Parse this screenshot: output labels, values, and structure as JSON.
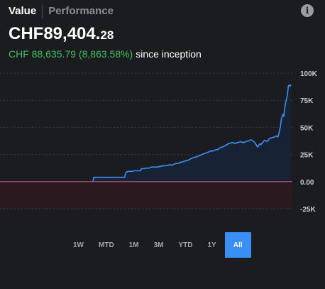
{
  "tabs": [
    {
      "label": "Value",
      "active": true
    },
    {
      "label": "Performance",
      "active": false
    }
  ],
  "info_icon": "info-icon",
  "portfolio": {
    "value_main": "CHF89,404.",
    "value_cents": "28",
    "change_amount": "CHF 88,635.79",
    "change_pct": "(8,863.58%)",
    "change_suffix": "since inception"
  },
  "colors": {
    "line": "#3b8ef5",
    "positive_fill": "#172334",
    "negative_fill": "#2a1a20",
    "baseline": "#b45a78",
    "positive_text": "#3fbf5f",
    "selected_range": "#3b8ef5"
  },
  "chart_data": {
    "type": "area",
    "y_ticks": [
      "100K",
      "75K",
      "50K",
      "25K",
      "0.00",
      "-25K"
    ],
    "ylim": [
      -25000,
      100000
    ],
    "gridlines": "dashed",
    "series": [
      {
        "values": [
          0,
          0,
          0,
          0,
          0,
          0,
          0,
          0,
          0,
          0,
          0,
          0,
          0,
          0,
          0,
          0,
          0,
          0,
          0,
          0,
          0,
          0,
          0,
          0,
          0,
          0,
          0,
          0,
          0,
          0,
          0,
          0,
          0,
          0,
          0,
          0,
          0,
          0,
          0,
          0,
          0,
          0,
          0,
          0,
          0,
          0,
          0,
          0,
          0,
          0,
          0,
          0,
          0,
          0,
          0,
          0,
          0,
          0,
          0,
          0,
          0,
          0,
          0,
          0,
          0,
          0,
          0,
          0,
          0,
          0,
          0,
          0,
          0,
          0,
          0,
          0,
          0,
          0,
          0,
          0,
          0,
          0,
          0,
          0,
          0,
          0,
          0,
          0,
          0,
          0,
          0,
          0,
          0,
          0,
          0,
          0,
          0,
          0,
          0,
          0,
          0,
          0,
          0,
          0,
          0,
          0,
          4000,
          4000,
          4000,
          4000,
          4000,
          4000,
          4000,
          4000,
          4000,
          4000,
          4000,
          4000,
          4000,
          4000,
          4000,
          4000,
          4000,
          4000,
          4000,
          4000,
          4000,
          4000,
          4000,
          4000,
          4000,
          4000,
          4000,
          4000,
          4000,
          4000,
          4000,
          4000,
          4000,
          4000,
          4000,
          4000,
          8000,
          9000,
          9000,
          9500,
          9500,
          9500,
          9500,
          9500,
          9500,
          10000,
          10000,
          10000,
          10000,
          10000,
          10000,
          10000,
          10000,
          10000,
          12000,
          12000,
          12000,
          12000,
          12000,
          12500,
          12500,
          12500,
          12500,
          12500,
          13000,
          13500,
          13500,
          13500,
          13500,
          13500,
          13500,
          13500,
          13500,
          13500,
          14000,
          14000,
          14000,
          14500,
          14500,
          14500,
          14500,
          14500,
          15000,
          15000,
          15000,
          15500,
          15500,
          15500,
          15000,
          15500,
          16000,
          16000,
          16500,
          16500,
          17000,
          17000,
          17000,
          17000,
          18000,
          18000,
          18000,
          18500,
          18500,
          19000,
          19500,
          19000,
          19500,
          20000,
          20000,
          21000,
          21000,
          21500,
          22000,
          22000,
          22500,
          22500,
          23000,
          23000,
          23500,
          24000,
          24000,
          24500,
          25000,
          25000,
          25500,
          26000,
          26000,
          26500,
          26500,
          27000,
          27500,
          28000,
          28000,
          28500,
          28000,
          28500,
          29000,
          29000,
          29500,
          29500,
          29500,
          30000,
          31000,
          31000,
          31500,
          32000,
          32000,
          32500,
          33000,
          33500,
          34000,
          34000,
          35000,
          35000,
          35500,
          35500,
          36000,
          36000,
          36000,
          35500,
          35000,
          35500,
          36000,
          36000,
          36500,
          36500,
          37000,
          36500,
          36000,
          36500,
          36000,
          36500,
          37000,
          37000,
          37500,
          37500,
          38000,
          38500,
          38500,
          38000,
          37500,
          37000,
          36000,
          35000,
          33500,
          32000,
          32500,
          34000,
          35000,
          34000,
          35000,
          36000,
          37000,
          38000,
          38000,
          37500,
          37000,
          38000,
          39000,
          40000,
          40000,
          40500,
          40500,
          41000,
          41000,
          41500,
          42000,
          42000,
          41000,
          43000,
          47000,
          50000,
          57000,
          60000,
          62000,
          60000,
          68000,
          73000,
          76000,
          80000,
          88000,
          89000,
          88000,
          89404
        ]
      }
    ],
    "final_value": 89404.28
  },
  "ranges": [
    {
      "label": "1W",
      "selected": false
    },
    {
      "label": "MTD",
      "selected": false
    },
    {
      "label": "1M",
      "selected": false
    },
    {
      "label": "3M",
      "selected": false
    },
    {
      "label": "YTD",
      "selected": false
    },
    {
      "label": "1Y",
      "selected": false
    },
    {
      "label": "All",
      "selected": true
    }
  ]
}
